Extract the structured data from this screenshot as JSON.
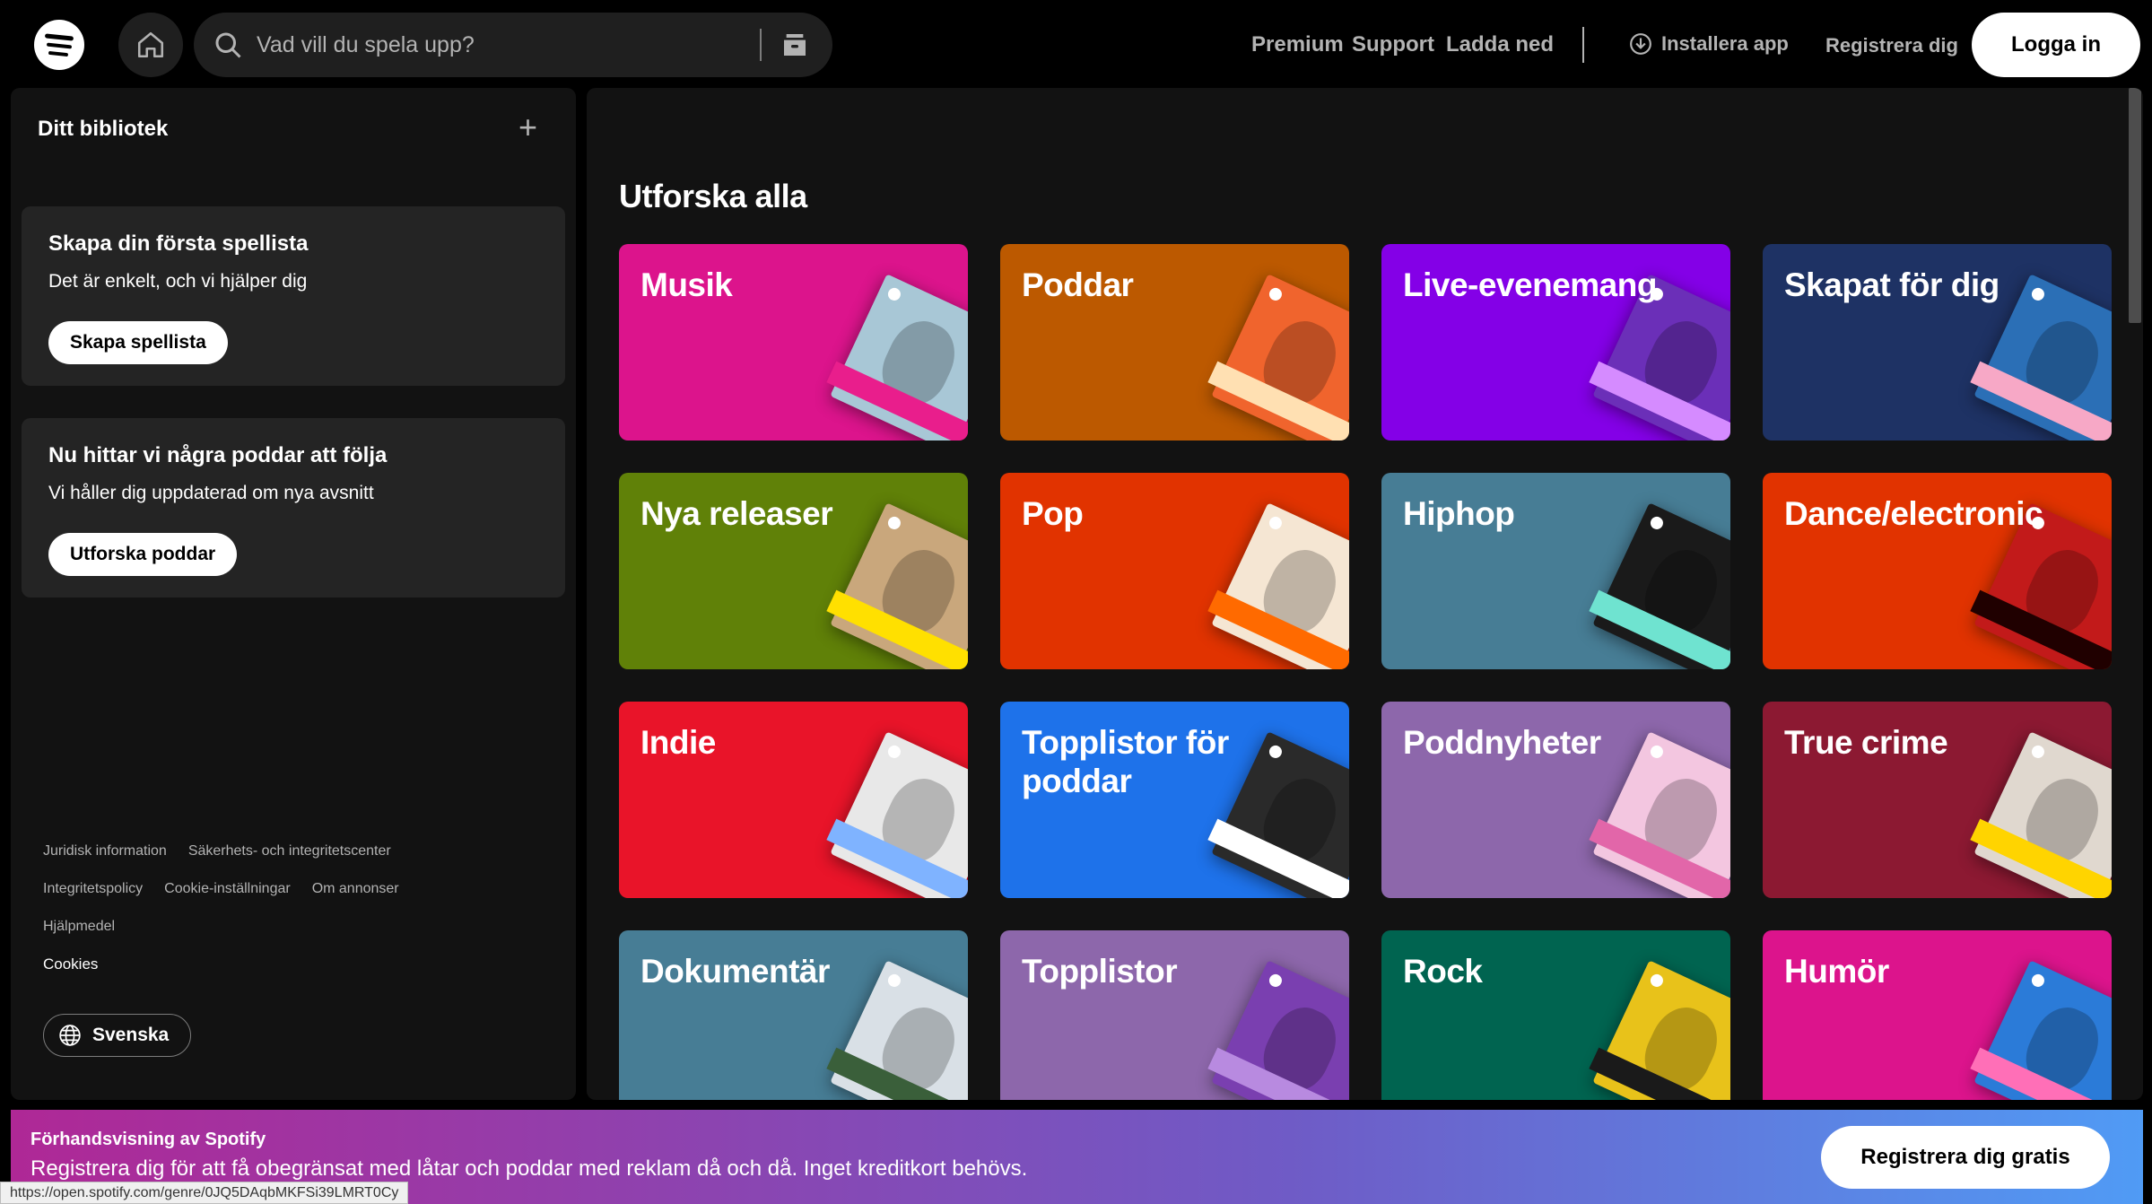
{
  "header": {
    "search_placeholder": "Vad vill du spela upp?",
    "nav": {
      "premium": "Premium",
      "support": "Support",
      "download": "Ladda ned"
    },
    "install_app": "Installera app",
    "register": "Registrera dig",
    "login": "Logga in"
  },
  "sidebar": {
    "library_title": "Ditt bibliotek",
    "playlist_card": {
      "title": "Skapa din första spellista",
      "text": "Det är enkelt, och vi hjälper dig",
      "button": "Skapa spellista"
    },
    "podcast_card": {
      "title": "Nu hittar vi några poddar att följa",
      "text": "Vi håller dig uppdaterad om nya avsnitt",
      "button": "Utforska poddar"
    },
    "legal_links": {
      "legal": "Juridisk information",
      "safety": "Säkerhets- och integritetscenter",
      "privacy": "Integritetspolicy",
      "cookie_settings": "Cookie-inställningar",
      "about_ads": "Om annonser",
      "accessibility": "Hjälpmedel",
      "cookies": "Cookies"
    },
    "language": "Svenska"
  },
  "main": {
    "title": "Utforska alla",
    "categories": [
      {
        "label": "Musik",
        "color": "#dc148c",
        "art": "#a8c7d6",
        "accent": "#e91e8c"
      },
      {
        "label": "Poddar",
        "color": "#bc5900",
        "art": "#f0642d",
        "accent": "#ffe0b2"
      },
      {
        "label": "Live-evenemang",
        "color": "#8400e7",
        "art": "#6b2fb8",
        "accent": "#d58bff"
      },
      {
        "label": "Skapat för dig",
        "color": "#1e3264",
        "art": "#2b6fb6",
        "accent": "#f7a8c6"
      },
      {
        "label": "Nya releaser",
        "color": "#608108",
        "art": "#c9a77c",
        "accent": "#ffe000"
      },
      {
        "label": "Pop",
        "color": "#e13300",
        "art": "#f5e6d3",
        "accent": "#ff6a00"
      },
      {
        "label": "Hiphop",
        "color": "#477d95",
        "art": "#1a1a1a",
        "accent": "#6fe3d0"
      },
      {
        "label": "Dance/electronic",
        "color": "#e13300",
        "art": "#c21a1a",
        "accent": "#200000"
      },
      {
        "label": "Indie",
        "color": "#e91429",
        "art": "#e8e8e8",
        "accent": "#7fb3ff"
      },
      {
        "label": "Topplistor för poddar",
        "color": "#1e72ea",
        "art": "#2a2a2a",
        "accent": "#ffffff"
      },
      {
        "label": "Poddnyheter",
        "color": "#8d67ab",
        "art": "#f3c6e0",
        "accent": "#e266a9"
      },
      {
        "label": "True crime",
        "color": "#8c1932",
        "art": "#e0d8cf",
        "accent": "#ffd400"
      },
      {
        "label": "Dokumentär",
        "color": "#477d95",
        "art": "#d9e0e6",
        "accent": "#3a5f3a"
      },
      {
        "label": "Topplistor",
        "color": "#8d67ab",
        "art": "#7a3fb0",
        "accent": "#b88ae0"
      },
      {
        "label": "Rock",
        "color": "#006450",
        "art": "#e8c21a",
        "accent": "#1a1a1a"
      },
      {
        "label": "Humör",
        "color": "#dc148c",
        "art": "#2b7bd8",
        "accent": "#ff6fb7"
      }
    ]
  },
  "banner": {
    "title": "Förhandsvisning av Spotify",
    "text": "Registrera dig för att få obegränsat med låtar och poddar med reklam då och då. Inget kreditkort behövs.",
    "button": "Registrera dig gratis"
  },
  "status_url": "https://open.spotify.com/genre/0JQ5DAqbMKFSi39LMRT0Cy"
}
